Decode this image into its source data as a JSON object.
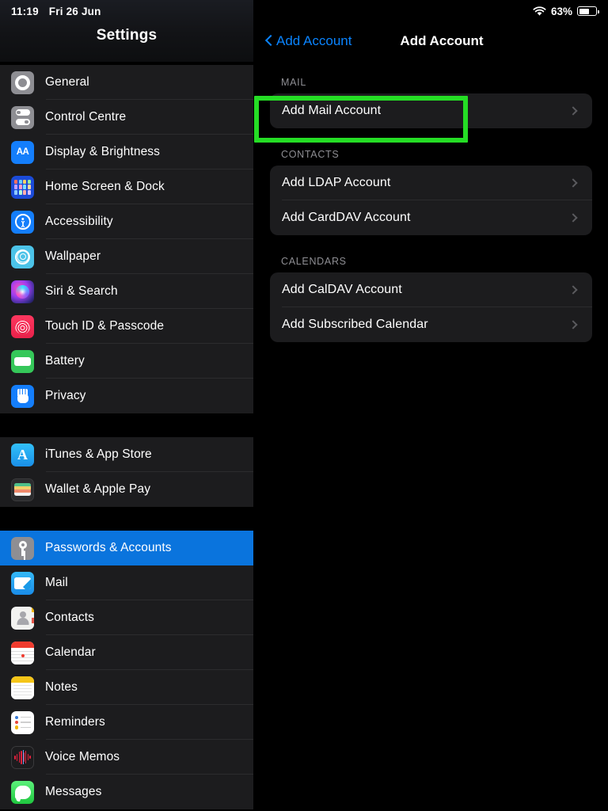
{
  "status_bar": {
    "time": "11:19",
    "date": "Fri 26 Jun",
    "battery_percent": "63%",
    "wifi_icon": "wifi-icon",
    "battery_icon": "battery-icon",
    "battery_level": 63
  },
  "sidebar": {
    "title": "Settings",
    "groups": [
      {
        "items": [
          {
            "label": "General",
            "icon": "gear-icon",
            "selected": false
          },
          {
            "label": "Control Centre",
            "icon": "control-centre-icon",
            "selected": false
          },
          {
            "label": "Display & Brightness",
            "icon": "display-brightness-icon",
            "selected": false
          },
          {
            "label": "Home Screen & Dock",
            "icon": "home-screen-dock-icon",
            "selected": false
          },
          {
            "label": "Accessibility",
            "icon": "accessibility-icon",
            "selected": false
          },
          {
            "label": "Wallpaper",
            "icon": "wallpaper-icon",
            "selected": false
          },
          {
            "label": "Siri & Search",
            "icon": "siri-search-icon",
            "selected": false
          },
          {
            "label": "Touch ID & Passcode",
            "icon": "touch-id-icon",
            "selected": false
          },
          {
            "label": "Battery",
            "icon": "battery-settings-icon",
            "selected": false
          },
          {
            "label": "Privacy",
            "icon": "privacy-hand-icon",
            "selected": false
          }
        ]
      },
      {
        "items": [
          {
            "label": "iTunes & App Store",
            "icon": "app-store-icon",
            "selected": false
          },
          {
            "label": "Wallet & Apple Pay",
            "icon": "wallet-icon",
            "selected": false
          }
        ]
      },
      {
        "items": [
          {
            "label": "Passwords & Accounts",
            "icon": "key-icon",
            "selected": true
          },
          {
            "label": "Mail",
            "icon": "mail-icon",
            "selected": false
          },
          {
            "label": "Contacts",
            "icon": "contacts-icon",
            "selected": false
          },
          {
            "label": "Calendar",
            "icon": "calendar-icon",
            "selected": false
          },
          {
            "label": "Notes",
            "icon": "notes-icon",
            "selected": false
          },
          {
            "label": "Reminders",
            "icon": "reminders-icon",
            "selected": false
          },
          {
            "label": "Voice Memos",
            "icon": "voice-memos-icon",
            "selected": false
          },
          {
            "label": "Messages",
            "icon": "messages-icon",
            "selected": false
          }
        ]
      }
    ]
  },
  "detail": {
    "back_label": "Add Account",
    "title": "Add Account",
    "sections": [
      {
        "header": "MAIL",
        "rows": [
          {
            "label": "Add Mail Account",
            "chevron": "chevron-right-icon",
            "highlighted": true
          }
        ]
      },
      {
        "header": "CONTACTS",
        "rows": [
          {
            "label": "Add LDAP Account",
            "chevron": "chevron-right-icon",
            "highlighted": false
          },
          {
            "label": "Add CardDAV Account",
            "chevron": "chevron-right-icon",
            "highlighted": false
          }
        ]
      },
      {
        "header": "CALENDARS",
        "rows": [
          {
            "label": "Add CalDAV Account",
            "chevron": "chevron-right-icon",
            "highlighted": false
          },
          {
            "label": "Add Subscribed Calendar",
            "chevron": "chevron-right-icon",
            "highlighted": false
          }
        ]
      }
    ]
  },
  "annotation": {
    "highlight_color": "#25dd25",
    "target": "Add Mail Account"
  },
  "colors": {
    "selection_blue": "#0a74dd",
    "link_blue": "#0a84ff",
    "card_bg": "#1c1c1e",
    "page_bg": "#000000",
    "section_header": "#8e8e93"
  }
}
